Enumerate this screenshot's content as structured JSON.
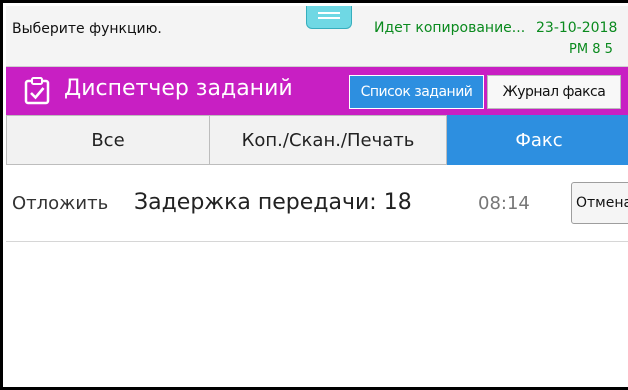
{
  "status_bar": {
    "prompt": "Выберите функцию.",
    "copy_status": "Идет копирование...",
    "date": "23-10-2018",
    "time": "PM 8 5"
  },
  "header": {
    "title": "Диспетчер заданий",
    "icon": "clipboard-check-icon",
    "job_list_label": "Список заданий",
    "fax_log_label": "Журнал факса"
  },
  "tabs": [
    {
      "label": "Все",
      "selected": false
    },
    {
      "label": "Коп./Скан./Печать",
      "selected": false
    },
    {
      "label": "Факс",
      "selected": true
    }
  ],
  "jobs": [
    {
      "status": "Отложить",
      "name": "Задержка передачи: 18",
      "time": "08:14",
      "cancel_label": "Отмена"
    }
  ],
  "colors": {
    "header_bg": "#c81fc3",
    "accent_blue": "#2d8fe0",
    "status_green": "#0a8a1e"
  }
}
